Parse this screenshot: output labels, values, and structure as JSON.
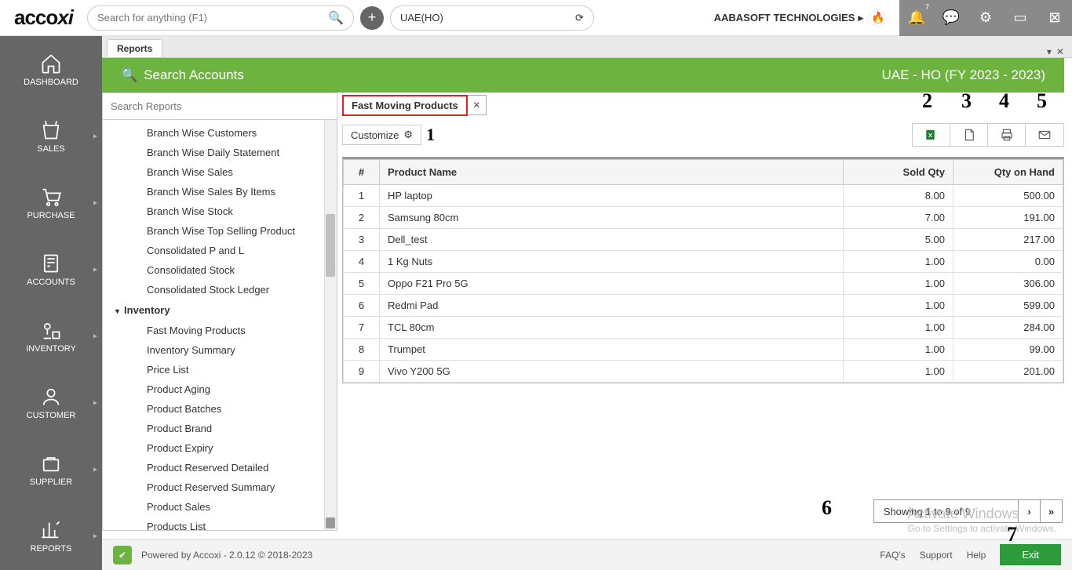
{
  "topbar": {
    "logo": "accoxi",
    "search_placeholder": "Search for anything (F1)",
    "location": "UAE(HO)",
    "company": "AABASOFT TECHNOLOGIES",
    "notif_count": "7"
  },
  "leftnav": [
    {
      "label": "DASHBOARD"
    },
    {
      "label": "SALES"
    },
    {
      "label": "PURCHASE"
    },
    {
      "label": "ACCOUNTS"
    },
    {
      "label": "INVENTORY"
    },
    {
      "label": "CUSTOMER"
    },
    {
      "label": "SUPPLIER"
    },
    {
      "label": "REPORTS"
    }
  ],
  "tabstrip": {
    "tab": "Reports"
  },
  "greenbar": {
    "left": "Search Accounts",
    "right": "UAE - HO (FY 2023 - 2023)"
  },
  "report_sidebar": {
    "placeholder": "Search Reports",
    "items": [
      "Branch Wise Customers",
      "Branch Wise Daily Statement",
      "Branch Wise Sales",
      "Branch Wise Sales By Items",
      "Branch Wise Stock",
      "Branch Wise Top Selling Product",
      "Consolidated P and L",
      "Consolidated Stock",
      "Consolidated Stock Ledger"
    ],
    "group": "Inventory",
    "items2": [
      "Fast Moving Products",
      "Inventory Summary",
      "Price List",
      "Product Aging",
      "Product Batches",
      "Product Brand",
      "Product Expiry",
      "Product Reserved Detailed",
      "Product Reserved Summary",
      "Product Sales",
      "Products List"
    ]
  },
  "subtab": "Fast Moving Products",
  "customize": "Customize",
  "table": {
    "headers": {
      "idx": "#",
      "name": "Product Name",
      "sold": "Sold Qty",
      "hand": "Qty on Hand"
    },
    "rows": [
      {
        "idx": "1",
        "name": "HP laptop",
        "sold": "8.00",
        "hand": "500.00"
      },
      {
        "idx": "2",
        "name": "Samsung 80cm",
        "sold": "7.00",
        "hand": "191.00"
      },
      {
        "idx": "3",
        "name": "Dell_test",
        "sold": "5.00",
        "hand": "217.00"
      },
      {
        "idx": "4",
        "name": "1 Kg Nuts",
        "sold": "1.00",
        "hand": "0.00"
      },
      {
        "idx": "5",
        "name": "Oppo F21 Pro 5G",
        "sold": "1.00",
        "hand": "306.00"
      },
      {
        "idx": "6",
        "name": "Redmi Pad",
        "sold": "1.00",
        "hand": "599.00"
      },
      {
        "idx": "7",
        "name": "TCL 80cm",
        "sold": "1.00",
        "hand": "284.00"
      },
      {
        "idx": "8",
        "name": "Trumpet",
        "sold": "1.00",
        "hand": "99.00"
      },
      {
        "idx": "9",
        "name": "Vivo Y200 5G",
        "sold": "1.00",
        "hand": "201.00"
      }
    ]
  },
  "pager": "Showing 1 to 9 of 9",
  "footer": {
    "powered": "Powered by Accoxi - 2.0.12 © 2018-2023",
    "links": [
      "FAQ's",
      "Support",
      "Help"
    ],
    "exit": "Exit"
  },
  "watermark": {
    "l1": "Activate Windows",
    "l2": "Go to Settings to activate Windows."
  },
  "annot": {
    "1": "1",
    "2": "2",
    "3": "3",
    "4": "4",
    "5": "5",
    "6": "6",
    "7": "7"
  }
}
